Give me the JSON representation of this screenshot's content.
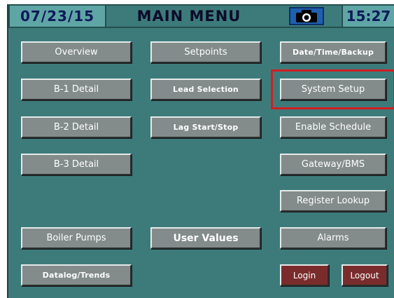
{
  "header": {
    "date": "07/23/15",
    "title": "MAIN MENU",
    "camera_icon": "camera-icon",
    "time": "15:27"
  },
  "buttons": {
    "overview": "Overview",
    "setpoints": "Setpoints",
    "date_time_backup": "Date/Time/Backup",
    "b1_detail": "B-1 Detail",
    "lead_selection": "Lead Selection",
    "system_setup": "System Setup",
    "b2_detail": "B-2 Detail",
    "lag_start_stop": "Lag Start/Stop",
    "enable_schedule": "Enable Schedule",
    "b3_detail": "B-3 Detail",
    "gateway_bms": "Gateway/BMS",
    "register_lookup": "Register Lookup",
    "boiler_pumps": "Boiler Pumps",
    "user_values": "User Values",
    "alarms": "Alarms",
    "datalog_trends": "Datalog/Trends",
    "login": "Login",
    "logout": "Logout"
  },
  "colors": {
    "background": "#3d7b7b",
    "button": "#838b8b",
    "login_logout": "#7a2c2c",
    "highlight": "#d11e22",
    "header_text": "#0d1a5a"
  }
}
